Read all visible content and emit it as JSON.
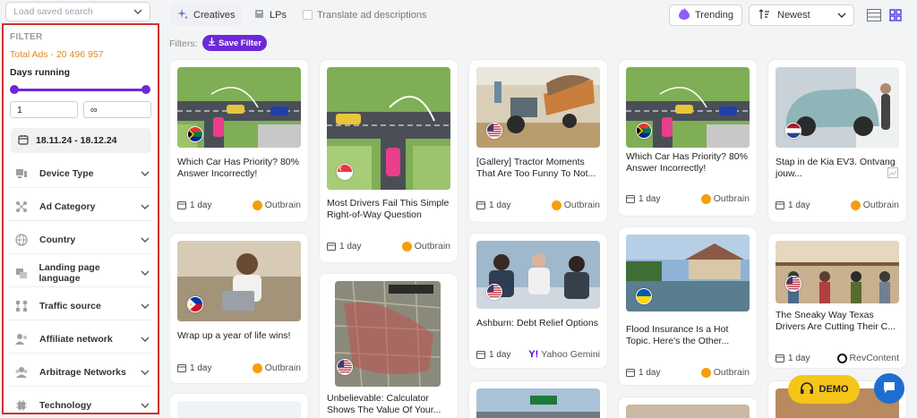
{
  "saved_search": {
    "placeholder": "Load saved search"
  },
  "sidebar": {
    "title": "FILTER",
    "total_ads": "Total Ads - 20 496 957",
    "days_running_label": "Days running",
    "days_min": "1",
    "days_max": "∞",
    "date_range": "18.11.24 - 18.12.24",
    "filters": [
      {
        "label": "Device Type",
        "icon": "device-icon"
      },
      {
        "label": "Ad Category",
        "icon": "category-icon"
      },
      {
        "label": "Country",
        "icon": "globe-icon"
      },
      {
        "label": "Landing page language",
        "icon": "language-icon"
      },
      {
        "label": "Traffic source",
        "icon": "traffic-source-icon"
      },
      {
        "label": "Affiliate network",
        "icon": "affiliate-icon"
      },
      {
        "label": "Arbitrage Networks",
        "icon": "arbitrage-icon"
      },
      {
        "label": "Technology",
        "icon": "technology-icon"
      }
    ]
  },
  "topbar": {
    "tab_creatives": "Creatives",
    "tab_lps": "LPs",
    "translate_label": "Translate ad descriptions",
    "trending_label": "Trending",
    "sort_label": "Newest",
    "filters_label": "Filters:",
    "save_filter_label": "Save Filter"
  },
  "cards": [
    {
      "title": "Which Car Has Priority? 80% Answer Incorrectly!",
      "days": "1 day",
      "network": "Outbrain",
      "flag": "za"
    },
    {
      "title": "Wrap up a year of life wins!",
      "days": "1 day",
      "network": "Outbrain",
      "flag": "ph"
    },
    {
      "title": "Most Drivers Fail This Simple Right-of-Way Question",
      "days": "1 day",
      "network": "Outbrain",
      "flag": "sg"
    },
    {
      "title": "Unbelievable: Calculator Shows The Value Of Your...",
      "days": "",
      "network": "",
      "flag": "us"
    },
    {
      "title": "[Gallery] Tractor Moments That Are Too Funny To Not...",
      "days": "1 day",
      "network": "Outbrain",
      "flag": "us"
    },
    {
      "title": "Ashburn: Debt Relief Options",
      "days": "1 day",
      "network": "Yahoo Gemini",
      "flag": "us"
    },
    {
      "title": "Which Car Has Priority? 80% Answer Incorrectly!",
      "days": "1 day",
      "network": "Outbrain",
      "flag": "za"
    },
    {
      "title": "Flood Insurance Is a Hot Topic. Here's the Other...",
      "days": "1 day",
      "network": "Outbrain",
      "flag": "ua"
    },
    {
      "title": "Stap in de Kia EV3. Ontvang jouw...",
      "days": "1 day",
      "network": "Outbrain",
      "flag": "nl"
    },
    {
      "title": "The Sneaky Way Texas Drivers Are Cutting Their C...",
      "days": "1 day",
      "network": "RevContent",
      "flag": "us"
    }
  ],
  "demo_label": "DEMO",
  "colors": {
    "accent": "#6d28d9",
    "highlight_border": "#d32f2f",
    "total_ads": "#e08a1e",
    "demo": "#f5c518",
    "chat": "#1c6fd1"
  }
}
